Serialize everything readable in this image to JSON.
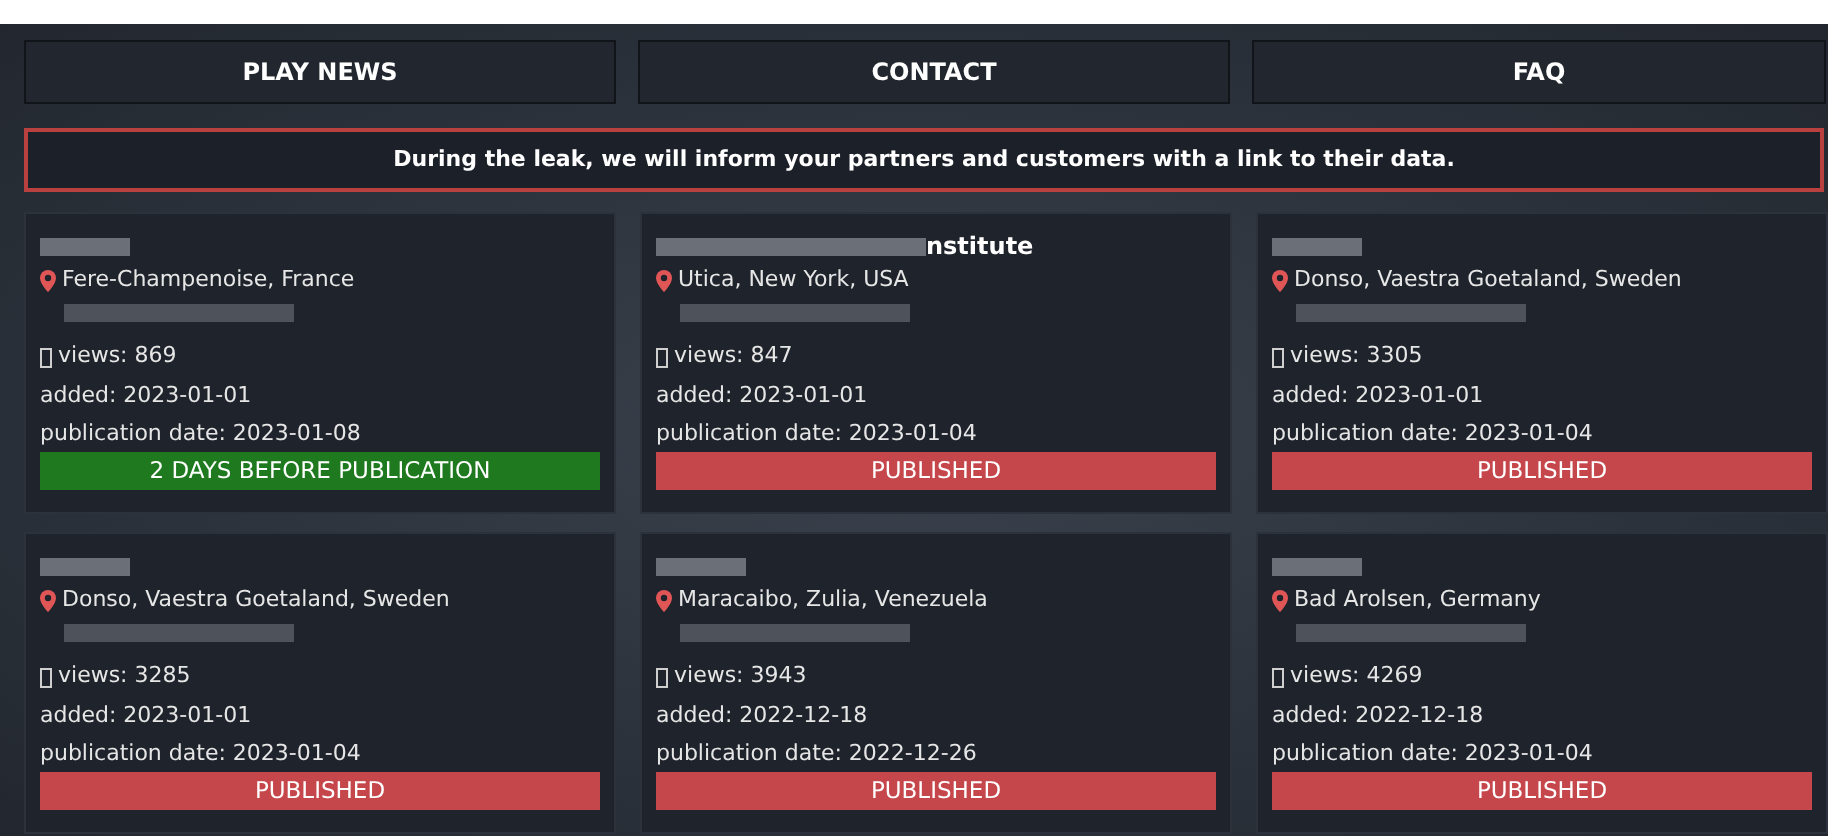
{
  "nav": [
    {
      "label": "PLAY NEWS"
    },
    {
      "label": "CONTACT"
    },
    {
      "label": "FAQ"
    }
  ],
  "banner": "During the leak, we will inform your partners and customers with a link to their data.",
  "cards": [
    {
      "location": "Fere-Champenoise, France",
      "views": "views: 869",
      "added": "added: 2023-01-01",
      "publication": "publication date: 2023-01-08",
      "status": {
        "kind": "countdown",
        "text": "2 DAYS BEFORE PUBLICATION"
      }
    },
    {
      "title_visible": "nstitute",
      "location": "Utica, New York, USA",
      "views": "views: 847",
      "added": "added: 2023-01-01",
      "publication": "publication date: 2023-01-04",
      "status": {
        "kind": "published",
        "text": "PUBLISHED"
      }
    },
    {
      "location": "Donso, Vaestra Goetaland, Sweden",
      "views": "views: 3305",
      "added": "added: 2023-01-01",
      "publication": "publication date: 2023-01-04",
      "status": {
        "kind": "published",
        "text": "PUBLISHED"
      }
    },
    {
      "location": "Donso, Vaestra Goetaland, Sweden",
      "views": "views: 3285",
      "added": "added: 2023-01-01",
      "publication": "publication date: 2023-01-04",
      "status": {
        "kind": "published",
        "text": "PUBLISHED"
      }
    },
    {
      "location": "Maracaibo, Zulia, Venezuela",
      "views": "views: 3943",
      "added": "added: 2022-12-18",
      "publication": "publication date: 2022-12-26",
      "status": {
        "kind": "published",
        "text": "PUBLISHED"
      }
    },
    {
      "location": "Bad Arolsen, Germany",
      "views": "views: 4269",
      "added": "added: 2022-12-18",
      "publication": "publication date: 2023-01-04",
      "status": {
        "kind": "published",
        "text": "PUBLISHED"
      }
    }
  ]
}
